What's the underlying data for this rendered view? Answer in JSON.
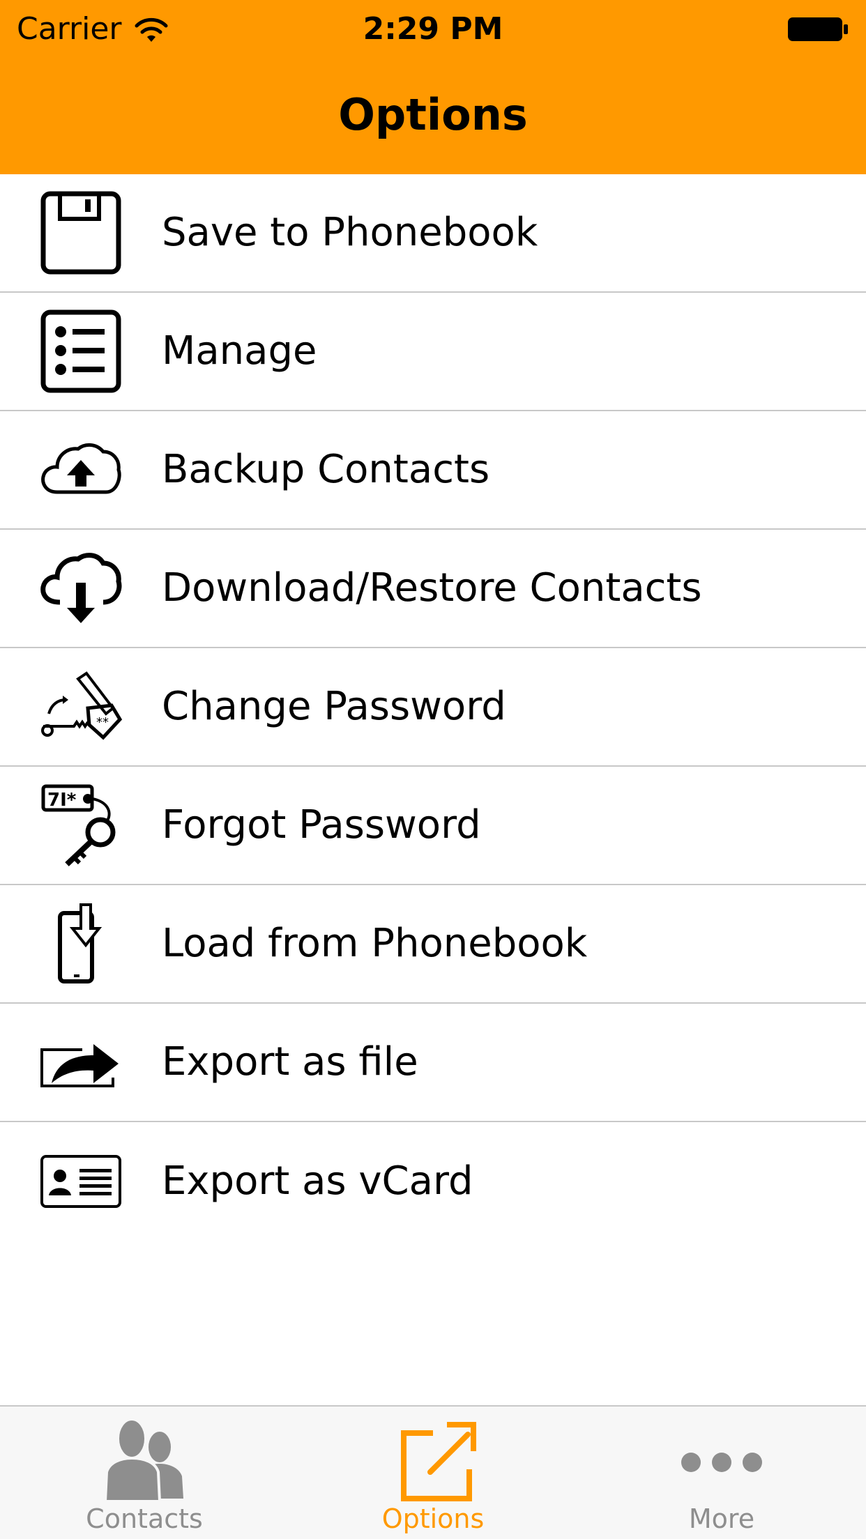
{
  "status_bar": {
    "carrier": "Carrier",
    "time": "2:29 PM"
  },
  "header": {
    "title": "Options",
    "background_color": "#FF9900"
  },
  "options": [
    {
      "label": "Save to Phonebook",
      "icon": "floppy-disk-icon"
    },
    {
      "label": "Manage",
      "icon": "list-icon"
    },
    {
      "label": "Backup Contacts",
      "icon": "cloud-upload-icon"
    },
    {
      "label": "Download/Restore Contacts",
      "icon": "cloud-download-icon"
    },
    {
      "label": "Change Password",
      "icon": "change-password-key-icon"
    },
    {
      "label": "Forgot Password",
      "icon": "forgot-password-key-icon"
    },
    {
      "label": "Load from Phonebook",
      "icon": "phone-download-icon"
    },
    {
      "label": "Export as file",
      "icon": "export-share-icon"
    },
    {
      "label": "Export as vCard",
      "icon": "vcard-icon"
    }
  ],
  "tabbar": {
    "tabs": [
      {
        "label": "Contacts",
        "icon": "contacts-icon",
        "active": false
      },
      {
        "label": "Options",
        "icon": "options-icon",
        "active": true
      },
      {
        "label": "More",
        "icon": "more-dots-icon",
        "active": false
      }
    ],
    "active_color": "#FF9900",
    "inactive_color": "#8e8e8e"
  }
}
